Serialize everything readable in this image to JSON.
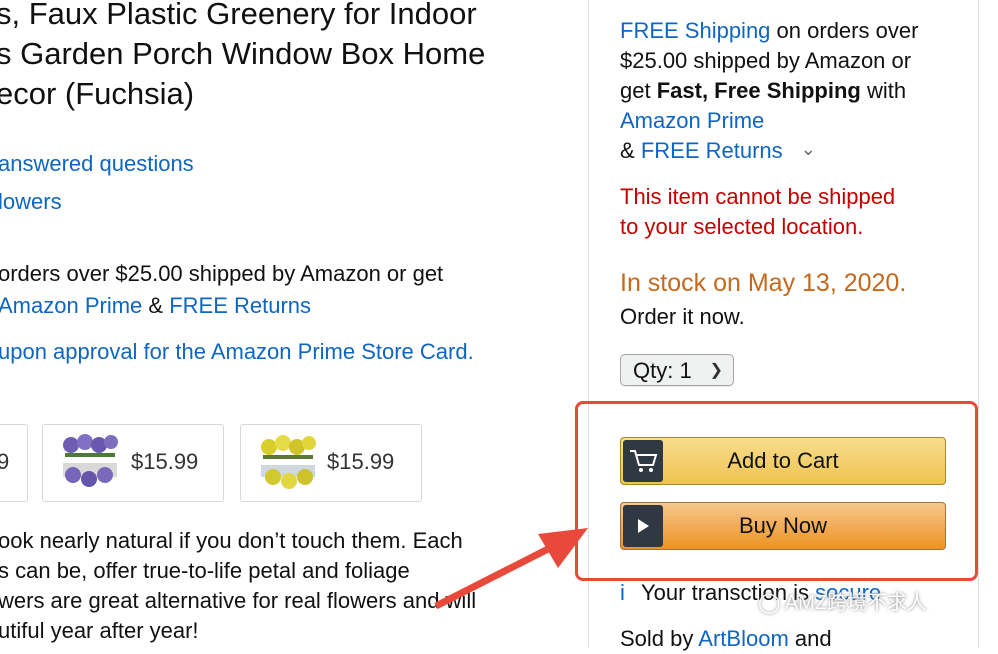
{
  "product": {
    "title_lines": [
      "s, Faux Plastic Greenery for Indoor",
      "s Garden Porch Window Box Home",
      "ecor (Fuchsia)"
    ],
    "links": {
      "answered": "answered questions",
      "flowers": "lowers"
    },
    "shipping_text": "orders over $25.00 shipped by Amazon or get",
    "prime_link": "Amazon Prime",
    "amp": "&",
    "free_returns_link": "FREE Returns",
    "store_card_link": "upon approval for the Amazon Prime Store Card.",
    "swatches": [
      {
        "price": "9"
      },
      {
        "price": "$15.99",
        "color": "#7b6bbd"
      },
      {
        "price": "$15.99",
        "color": "#d8cf3a"
      }
    ],
    "description_lines": [
      "ook nearly natural if you don’t touch them. Each",
      "s can be, offer true-to-life petal and foliage",
      "wers are great alternative for real flowers and will",
      "utiful year after year!"
    ]
  },
  "buybox": {
    "free_shipping_link": "FREE Shipping",
    "ship_line1_rest": "on orders over",
    "ship_line2": "$25.00 shipped by Amazon or",
    "ship_line3_pre": "get",
    "ship_line3_bold": "Fast, Free Shipping",
    "ship_line3_post": "with",
    "prime_link": "Amazon Prime",
    "amp": "&",
    "free_returns_link": "FREE Returns",
    "cannot_ship_line1": "This item cannot be shipped",
    "cannot_ship_line2": "to your selected location.",
    "stock_text": "In stock on May 13, 2020.",
    "order_now": "Order it now.",
    "qty_label": "Qty: 1",
    "add_to_cart": "Add to Cart",
    "buy_now": "Buy Now",
    "transaction_text": "Your trans",
    "transaction_text2": "ction is ",
    "secure_link": "secure",
    "sold_by_pre": "Sold by",
    "seller_link": "ArtBloom",
    "sold_by_post": "and"
  },
  "watermark": "AMZ跨境不求人",
  "colors": {
    "link": "#0f66c0",
    "red": "#c40000",
    "stock": "#c7681c",
    "highlight": "#e8493a"
  }
}
